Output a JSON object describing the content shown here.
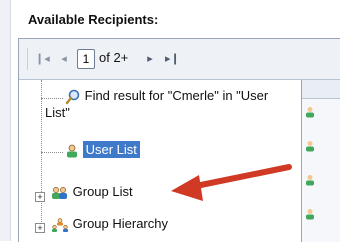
{
  "section_title": "Available Recipients:",
  "pager": {
    "first_icon": "first-page-icon",
    "prev_icon": "prev-page-icon",
    "page_value": "1",
    "of_text": "of 2+",
    "next_icon": "next-page-icon",
    "last_icon": "last-page-icon"
  },
  "tree": {
    "items": [
      {
        "label": "Find result for \"Cmerle\" in \"User",
        "label2": "List\"",
        "icon": "search-icon"
      },
      {
        "label": "User List",
        "icon": "user-icon",
        "selected": true
      },
      {
        "label": "Group List",
        "icon": "group-icon"
      },
      {
        "label": "Group Hierarchy",
        "icon": "hierarchy-icon"
      }
    ]
  },
  "colors": {
    "selection": "#3f79c9",
    "arrow": "#d03a24"
  }
}
